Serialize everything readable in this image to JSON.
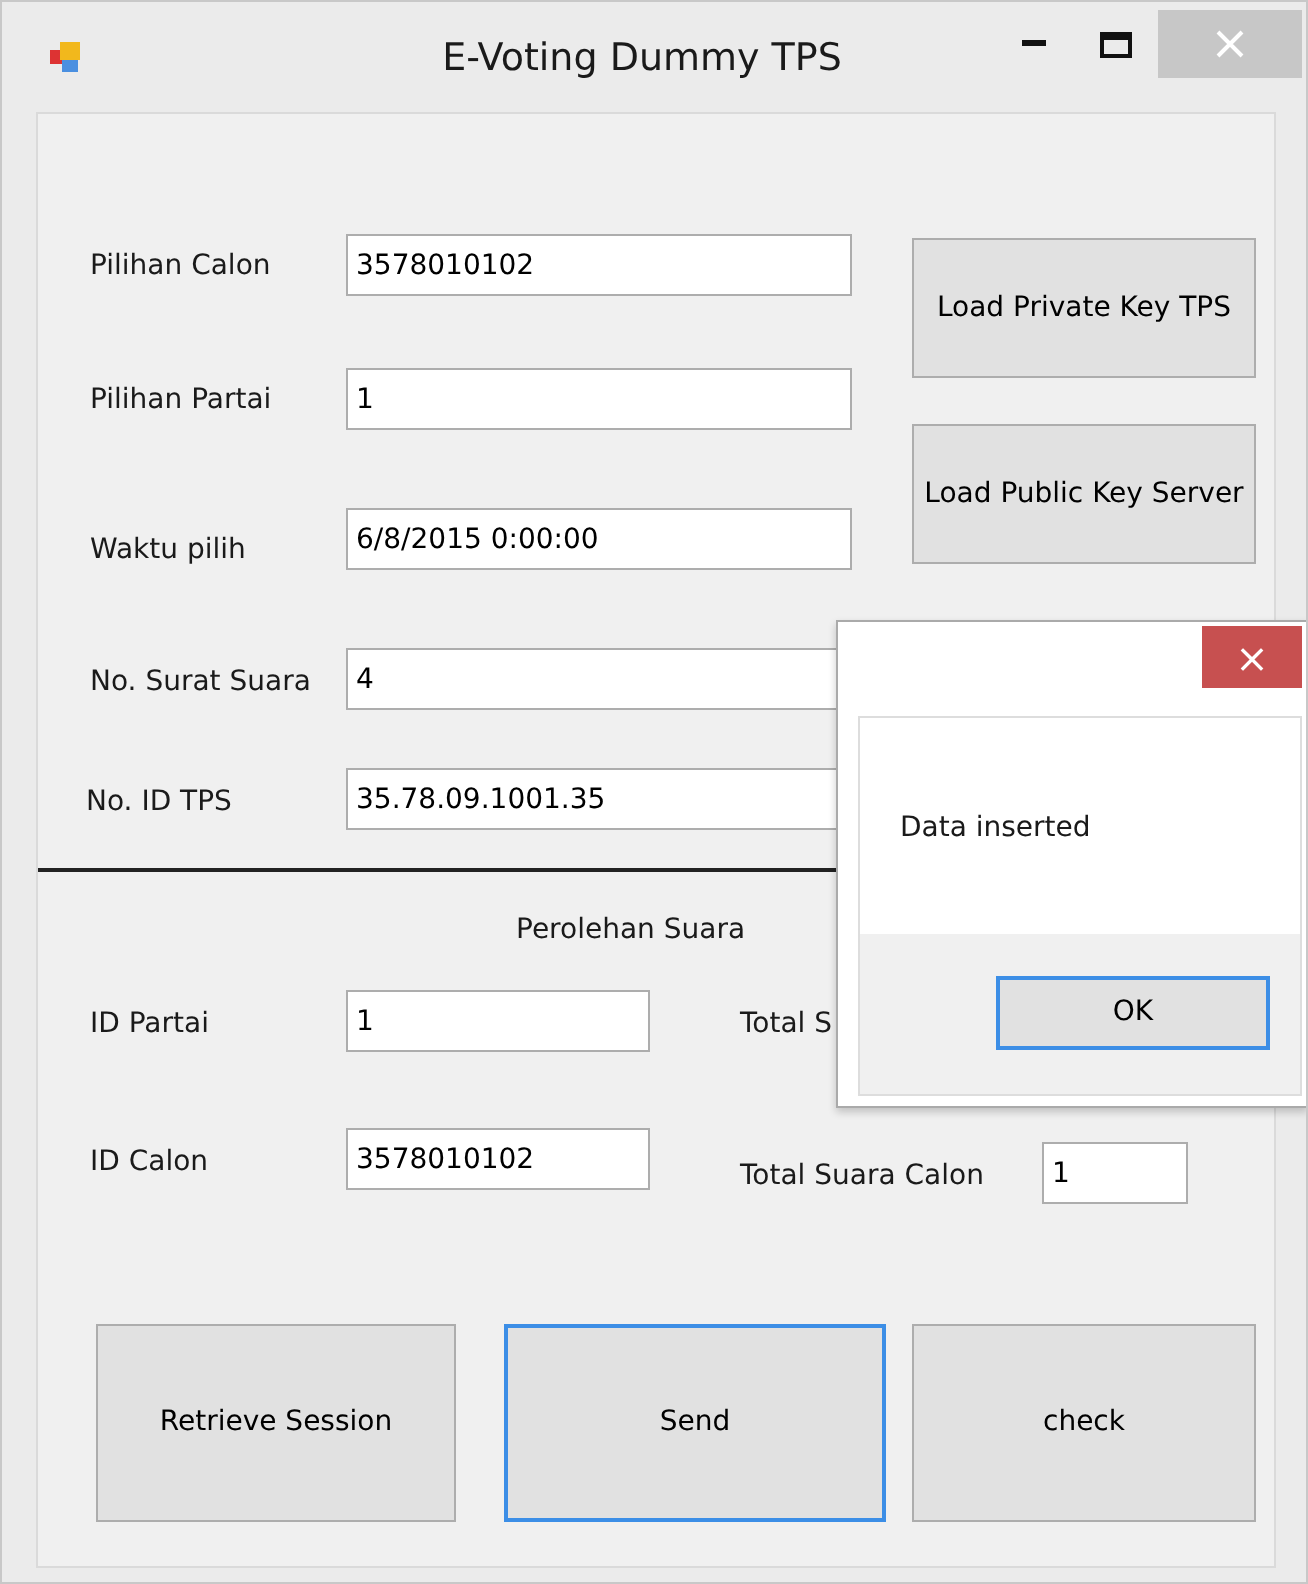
{
  "window": {
    "title": "E-Voting Dummy TPS"
  },
  "fields": [
    {
      "label": "Pilihan Calon",
      "value": "3578010102"
    },
    {
      "label": "Pilihan Partai",
      "value": "1"
    },
    {
      "label": "Waktu pilih",
      "value": "6/8/2015 0:00:00"
    },
    {
      "label": "No. Surat Suara",
      "value": "4"
    },
    {
      "label": "No. ID TPS",
      "value": "35.78.09.1001.35"
    }
  ],
  "key_buttons": [
    {
      "label": "Load Private Key TPS",
      "focused": false
    },
    {
      "label": "Load Public Key Server",
      "focused": false
    }
  ],
  "section_title": "Perolehan Suara",
  "result_fields": [
    {
      "label": "ID Partai",
      "value": "1"
    },
    {
      "label": "ID Calon",
      "value": "3578010102"
    },
    {
      "label": "Total S"
    },
    {
      "label": "Total Suara Calon",
      "value": "1"
    }
  ],
  "action_buttons": [
    {
      "label": "Retrieve Session",
      "focused": false
    },
    {
      "label": "Send",
      "focused": true
    },
    {
      "label": "check",
      "focused": false
    }
  ],
  "dialog": {
    "close": "×",
    "message": "Data inserted",
    "button": {
      "label": "OK",
      "focused": true
    }
  }
}
